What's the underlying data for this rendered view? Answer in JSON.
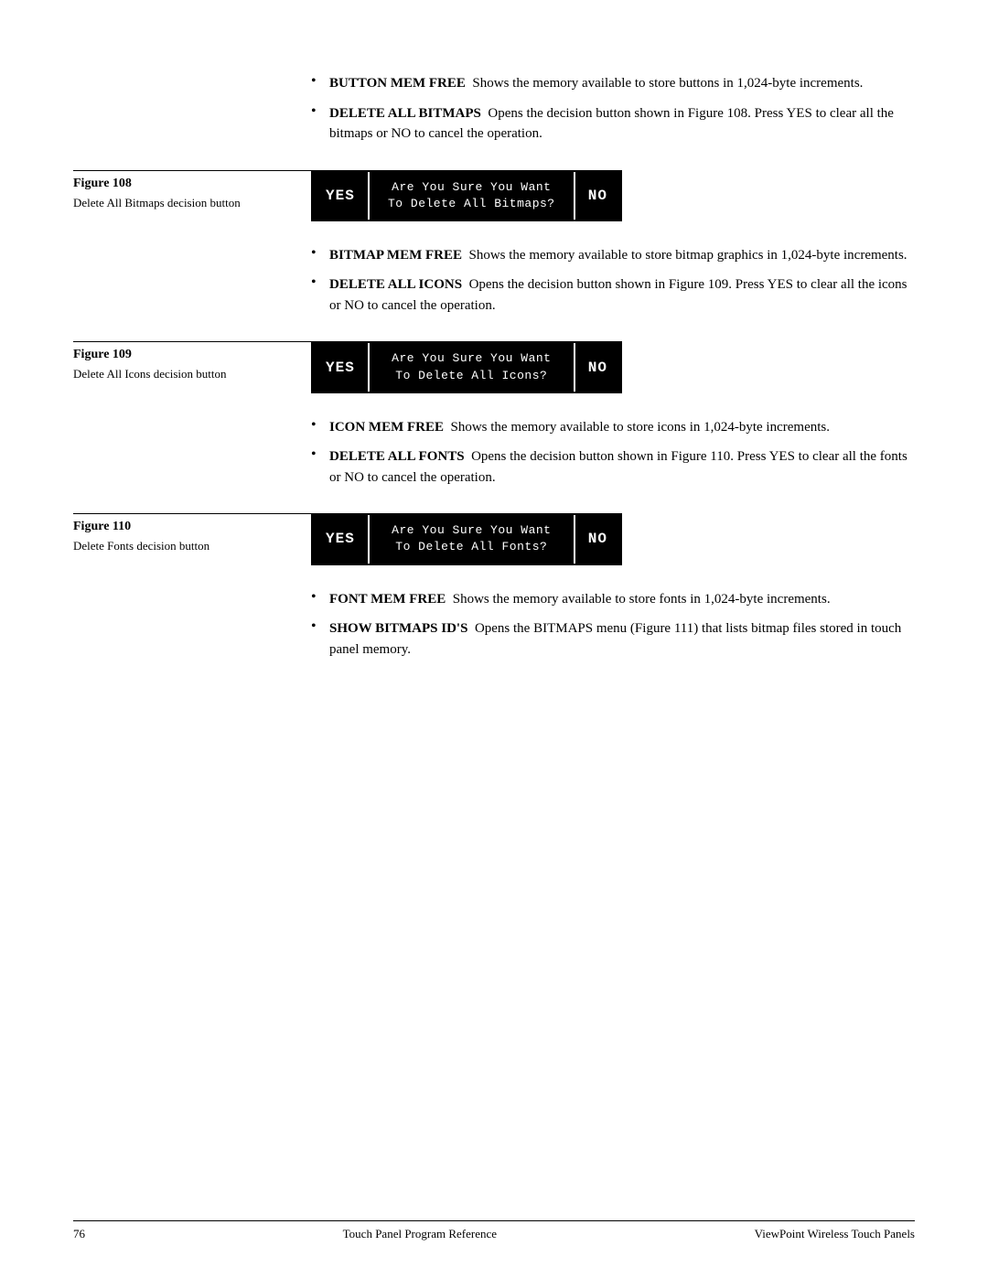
{
  "page": {
    "footer": {
      "page_number": "76",
      "left_text": "Touch Panel Program Reference",
      "right_text": "ViewPoint Wireless Touch Panels"
    }
  },
  "bullets_top": [
    {
      "id": "button-mem-free",
      "bold": "BUTTON MEM FREE",
      "text": "Shows the memory available to store buttons in 1,024-byte increments."
    },
    {
      "id": "delete-all-bitmaps",
      "bold": "DELETE ALL BITMAPS",
      "text": "Opens the decision button shown in Figure 108. Press YES to clear all the bitmaps or NO to cancel the operation."
    }
  ],
  "figure_108": {
    "number": "Figure 108",
    "caption": "Delete All Bitmaps decision button",
    "yes_label": "YES",
    "message_line1": "Are You Sure You Want",
    "message_line2": "To Delete All Bitmaps?",
    "no_label": "NO"
  },
  "bullets_mid1": [
    {
      "id": "bitmap-mem-free",
      "bold": "BITMAP MEM FREE",
      "text": "Shows the memory available to store bitmap graphics in 1,024-byte increments."
    },
    {
      "id": "delete-all-icons",
      "bold": "DELETE ALL ICONS",
      "text": "Opens the decision button shown in Figure 109. Press YES to clear all the icons or NO to cancel the operation."
    }
  ],
  "figure_109": {
    "number": "Figure 109",
    "caption": "Delete All Icons decision button",
    "yes_label": "YES",
    "message_line1": "Are You Sure You Want",
    "message_line2": "To Delete All Icons?",
    "no_label": "NO"
  },
  "bullets_mid2": [
    {
      "id": "icon-mem-free",
      "bold": "ICON MEM FREE",
      "text": "Shows the memory available to store icons in 1,024-byte increments."
    },
    {
      "id": "delete-all-fonts",
      "bold": "DELETE ALL FONTS",
      "text": "Opens the decision button shown in Figure 110. Press YES to clear all the fonts or NO to cancel the operation."
    }
  ],
  "figure_110": {
    "number": "Figure 110",
    "caption": "Delete Fonts decision button",
    "yes_label": "YES",
    "message_line1": "Are You Sure You Want",
    "message_line2": "To Delete All Fonts?",
    "no_label": "NO"
  },
  "bullets_bottom": [
    {
      "id": "font-mem-free",
      "bold": "FONT MEM FREE",
      "text": "Shows the memory available to store fonts in 1,024-byte increments."
    },
    {
      "id": "show-bitmaps-ids",
      "bold": "SHOW BITMAPS ID'S",
      "text": "Opens the BITMAPS menu (Figure 111) that lists bitmap files stored in touch panel memory."
    }
  ]
}
